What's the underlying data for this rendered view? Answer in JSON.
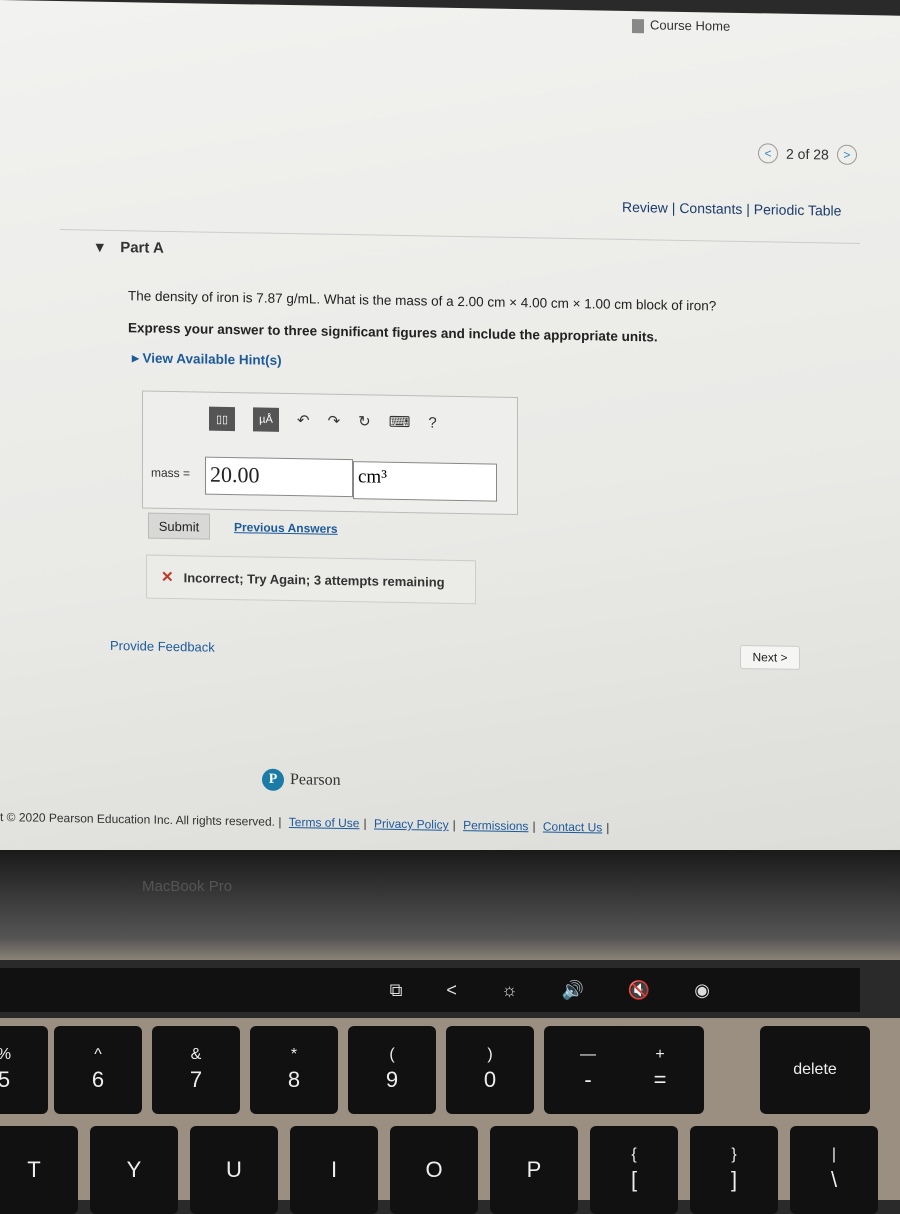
{
  "nav": {
    "course_home": "Course Home",
    "pager": "2 of 28",
    "prev": "<",
    "next": ">",
    "links": "Review | Constants | Periodic Table"
  },
  "part": {
    "label": "Part A",
    "question": "The density of iron is 7.87 g/mL. What is the mass of a 2.00 cm × 4.00 cm × 1.00 cm block of iron?",
    "instruction": "Express your answer to three significant figures and include the appropriate units.",
    "hint": "View Available Hint(s)"
  },
  "answer": {
    "toolbar": [
      "templates-icon",
      "µÅ",
      "undo-icon",
      "redo-icon",
      "reset-icon",
      "keyboard-icon",
      "?"
    ],
    "mass_label": "mass =",
    "value": "20.00",
    "unit": "cm³"
  },
  "actions": {
    "submit": "Submit",
    "previous": "Previous Answers"
  },
  "feedback": {
    "icon": "✕",
    "text": "Incorrect; Try Again; 3 attempts remaining"
  },
  "provide_feedback": "Provide Feedback",
  "next_button": "Next >",
  "brand": {
    "name": "Pearson"
  },
  "footer": {
    "copyright": "t © 2020 Pearson Education Inc. All rights reserved. |",
    "links": [
      "Terms of Use",
      "Privacy Policy",
      "Permissions",
      "Contact Us"
    ]
  },
  "device": {
    "label": "MacBook Pro"
  },
  "touchbar": [
    "⧉",
    "<",
    "☼",
    "🔊",
    "🔇",
    "◉"
  ],
  "keys": [
    {
      "top": "%",
      "bottom": "5"
    },
    {
      "top": "^",
      "bottom": "6"
    },
    {
      "top": "&",
      "bottom": "7"
    },
    {
      "top": "*",
      "bottom": "8"
    },
    {
      "top": "(",
      "bottom": "9"
    },
    {
      "top": ")",
      "bottom": "0"
    },
    {
      "top": "—",
      "bottom": "-"
    },
    {
      "top": "+",
      "bottom": "="
    },
    {
      "top": "delete",
      "bottom": ""
    },
    {
      "top": "",
      "bottom": "T"
    },
    {
      "top": "",
      "bottom": "Y"
    },
    {
      "top": "",
      "bottom": "U"
    },
    {
      "top": "",
      "bottom": "I"
    },
    {
      "top": "",
      "bottom": "O"
    },
    {
      "top": "",
      "bottom": "P"
    },
    {
      "top": "{",
      "bottom": "["
    },
    {
      "top": "}",
      "bottom": "]"
    },
    {
      "top": "|",
      "bottom": "\\"
    }
  ],
  "colors": {
    "link": "#1d5a9a",
    "error": "#c0392b",
    "pearson": "#1a7ba6"
  }
}
